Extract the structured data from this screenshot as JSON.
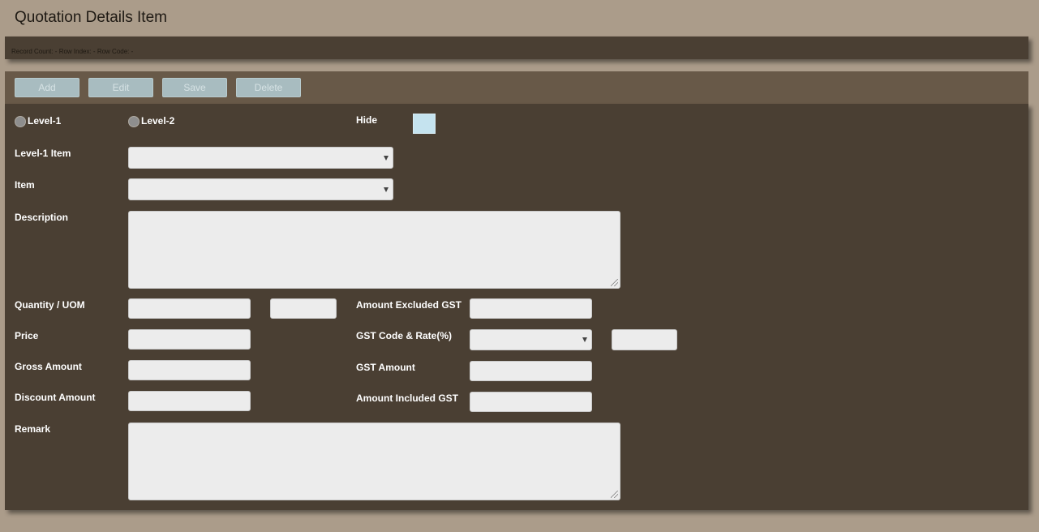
{
  "page": {
    "title": "Quotation Details Item",
    "status": "Record Count: - Row Index: - Row Code: -"
  },
  "toolbar": {
    "add_label": "Add",
    "edit_label": "Edit",
    "save_label": "Save",
    "delete_label": "Delete"
  },
  "form": {
    "level1_radio_label": "Level-1",
    "level2_radio_label": "Level-2",
    "hide_label": "Hide",
    "level1_item_label": "Level-1 Item",
    "item_label": "Item",
    "description_label": "Description",
    "quantity_uom_label": "Quantity / UOM",
    "price_label": "Price",
    "gross_amount_label": "Gross Amount",
    "discount_amount_label": "Discount Amount",
    "remark_label": "Remark",
    "amount_excluded_gst_label": "Amount Excluded GST",
    "gst_code_rate_label": "GST Code & Rate(%)",
    "gst_amount_label": "GST Amount",
    "amount_included_gst_label": "Amount Included GST",
    "values": {
      "level1_item": "",
      "item": "",
      "description": "",
      "quantity": "",
      "uom": "",
      "price": "",
      "gross_amount": "",
      "discount_amount": "",
      "remark": "",
      "amount_excluded_gst": "",
      "gst_code": "",
      "gst_rate": "",
      "gst_amount": "",
      "amount_included_gst": ""
    }
  },
  "colors": {
    "page_bg": "#ab9c8a",
    "panel_bg": "#4a3f33",
    "toolbar_bg": "#685948",
    "button_bg": "#a8bcc0",
    "field_bg": "#ececec",
    "checkbox_bg": "#c5e3ef"
  },
  "icons": {
    "dropdown": "chevron-down-icon",
    "resize": "resize-grip-icon"
  }
}
